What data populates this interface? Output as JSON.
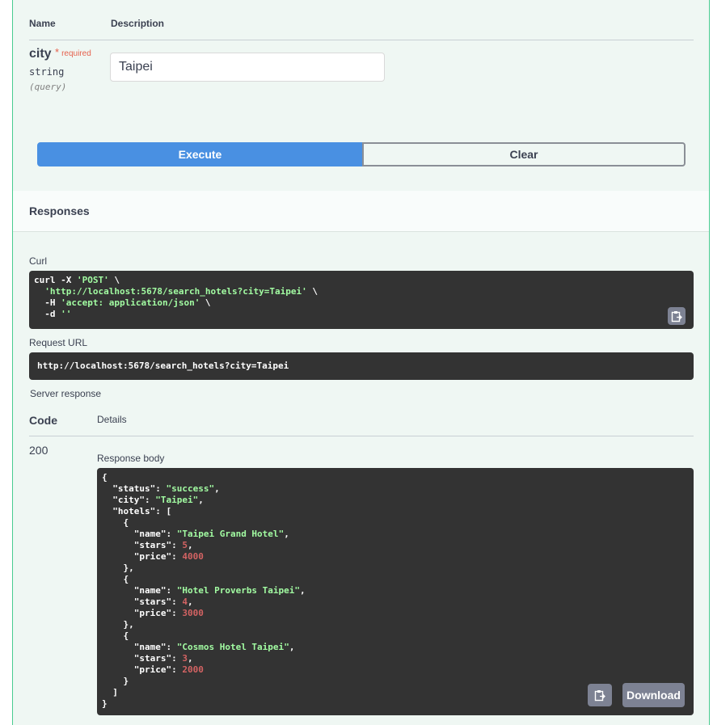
{
  "parameters": {
    "col_name": "Name",
    "col_description": "Description",
    "param": {
      "name": "city",
      "required_star": "*",
      "required_label": "required",
      "type": "string",
      "location": "(query)",
      "value": "Taipei"
    }
  },
  "actions": {
    "execute_label": "Execute",
    "clear_label": "Clear"
  },
  "responses": {
    "title": "Responses",
    "curl_label": "Curl",
    "curl": {
      "l1_cmd": "curl -X ",
      "l1_method": "'POST'",
      "l1_tail": " \\",
      "l2_url": "'http://localhost:5678/search_hotels?city=Taipei'",
      "l2_tail": " \\",
      "l3_flag": "-H ",
      "l3_header": "'accept: application/json'",
      "l3_tail": " \\",
      "l4_flag": "-d ",
      "l4_data": "''"
    },
    "request_url_label": "Request URL",
    "request_url": "http://localhost:5678/search_hotels?city=Taipei",
    "server_response_label": "Server response",
    "col_code": "Code",
    "col_details": "Details",
    "status_code": "200",
    "response_body_label": "Response body",
    "download_label": "Download",
    "body": {
      "status": "success",
      "city": "Taipei",
      "hotels": [
        {
          "name": "Taipei Grand Hotel",
          "stars": "5",
          "price": "4000"
        },
        {
          "name": "Hotel Proverbs Taipei",
          "stars": "4",
          "price": "3000"
        },
        {
          "name": "Cosmos Hotel Taipei",
          "stars": "3",
          "price": "2000"
        }
      ]
    }
  },
  "icons": {
    "copy": "clipboard-icon"
  }
}
